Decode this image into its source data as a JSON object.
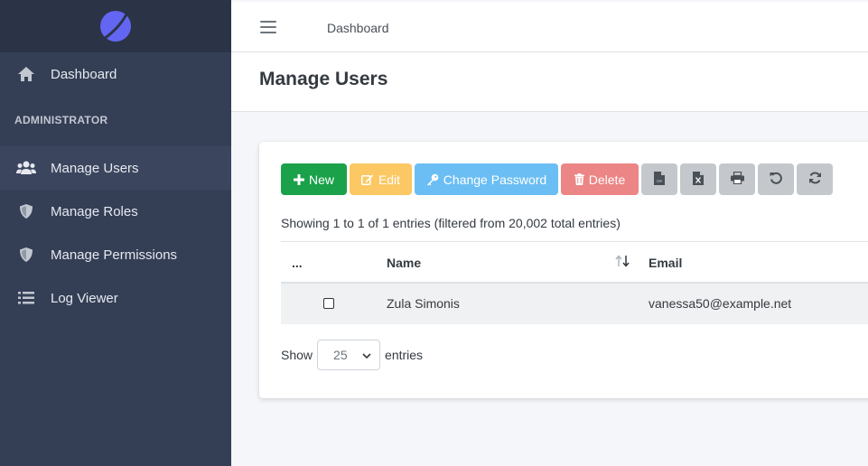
{
  "sidebar": {
    "items": [
      {
        "label": "Dashboard",
        "icon": "home-icon"
      },
      {
        "label": "Manage Users",
        "icon": "users-icon"
      },
      {
        "label": "Manage Roles",
        "icon": "shield-icon"
      },
      {
        "label": "Manage Permissions",
        "icon": "shield-icon"
      },
      {
        "label": "Log Viewer",
        "icon": "list-icon"
      }
    ],
    "section_label": "ADMINISTRATOR"
  },
  "topbar": {
    "link": "Dashboard"
  },
  "page": {
    "title": "Manage Users"
  },
  "toolbar": {
    "new_label": "New",
    "edit_label": "Edit",
    "change_password_label": "Change Password",
    "delete_label": "Delete"
  },
  "table": {
    "info": "Showing 1 to 1 of 1 entries (filtered from 20,002 total entries)",
    "headers": [
      "...",
      "Name",
      "Email"
    ],
    "rows": [
      {
        "name": "Zula Simonis",
        "email": "vanessa50@example.net"
      }
    ]
  },
  "pagination": {
    "show_label": "Show",
    "page_size": "25",
    "entries_label": "entries"
  },
  "colors": {
    "sidebar": "#343f56",
    "new": "#1aa14a",
    "edit": "#fbc863",
    "change_password": "#6bbef3",
    "delete": "#ec8585"
  }
}
